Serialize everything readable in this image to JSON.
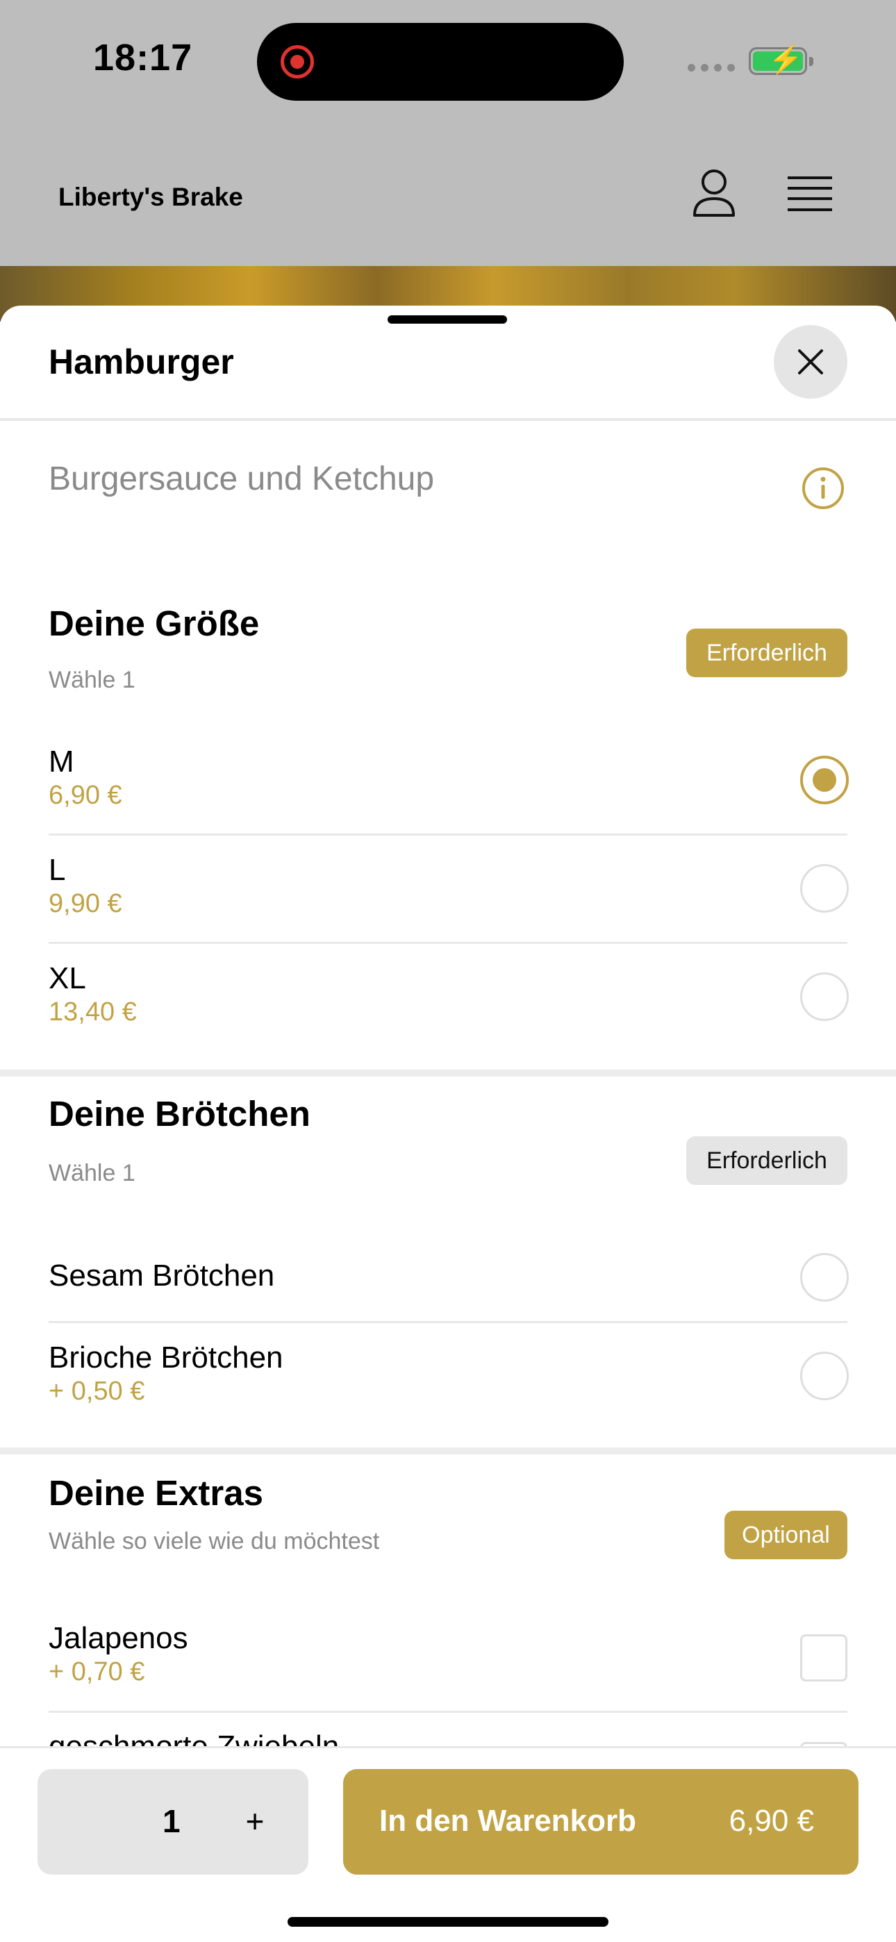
{
  "status_bar": {
    "time": "18:17"
  },
  "header": {
    "brand": "Liberty's Brake"
  },
  "sheet": {
    "title": "Hamburger",
    "description": "Burgersauce und Ketchup"
  },
  "sections": [
    {
      "title": "Deine Größe",
      "subtitle": "Wähle 1",
      "badge": "Erforderlich",
      "options": [
        {
          "label": "M",
          "price": "6,90 €",
          "selected": true
        },
        {
          "label": "L",
          "price": "9,90 €",
          "selected": false
        },
        {
          "label": "XL",
          "price": "13,40 €",
          "selected": false
        }
      ]
    },
    {
      "title": "Deine Brötchen",
      "subtitle": "Wähle 1",
      "badge": "Erforderlich",
      "options": [
        {
          "label": "Sesam Brötchen",
          "price": "",
          "selected": false
        },
        {
          "label": "Brioche Brötchen",
          "price": "+ 0,50 €",
          "selected": false
        }
      ]
    },
    {
      "title": "Deine Extras",
      "subtitle": "Wähle so viele wie du möchtest",
      "badge": "Optional",
      "options": [
        {
          "label": "Jalapenos",
          "price": "+ 0,70 €",
          "checked": false
        },
        {
          "label": "geschmorte Zwiebeln",
          "price": "",
          "checked": false
        }
      ]
    }
  ],
  "bottom_bar": {
    "quantity": "1",
    "plus": "+",
    "add_to_cart_label": "In den Warenkorb",
    "total_price": "6,90 €"
  },
  "colors": {
    "accent": "#c1a345",
    "badge_grey": "#e5e5e5",
    "divider": "#e8e8e8"
  }
}
